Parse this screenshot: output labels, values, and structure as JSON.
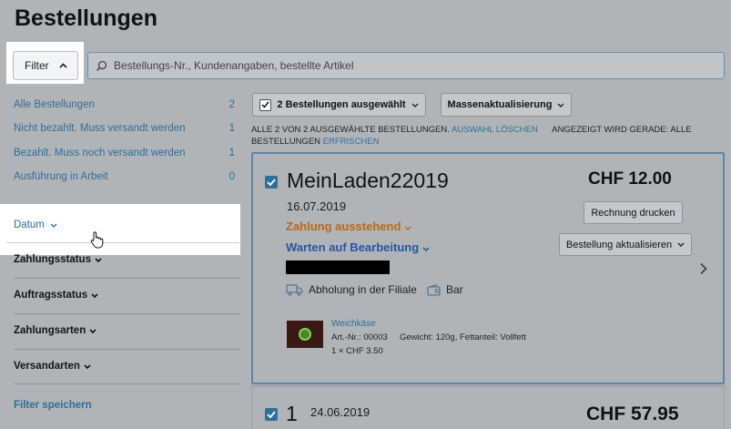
{
  "page": {
    "title": "Bestellungen"
  },
  "filter_button": {
    "label": "Filter"
  },
  "search": {
    "placeholder": "Bestellungs-Nr., Kundenangaben, bestellte Artikel"
  },
  "sidebar": {
    "views": [
      {
        "label": "Alle Bestellungen",
        "count": "2"
      },
      {
        "label": "Nicht bezahlt. Muss versandt werden",
        "count": "1"
      },
      {
        "label": "Bezahlt. Muss noch versandt werden",
        "count": "1"
      },
      {
        "label": "Ausführung in Arbeit",
        "count": "0"
      }
    ],
    "date_filter": "Datum",
    "sections": [
      "Zahlungsstatus",
      "Auftragsstatus",
      "Zahlungsarten",
      "Versandarten"
    ],
    "save_filter": "Filter speichern"
  },
  "toolbar": {
    "selected_label": "2 Bestellungen ausgewählt",
    "mass_update_label": "Massenaktualisierung"
  },
  "selection_info": {
    "text": "Alle 2 von 2 ausgewählte Bestellungen.",
    "clear_link": "Auswahl löschen",
    "showing_text": "Angezeigt wird gerade: Alle Bestellungen",
    "refresh_link": "Erfrischen"
  },
  "orders": [
    {
      "number": "MeinLaden22019",
      "date": "16.07.2019",
      "payment_status": "Zahlung ausstehend",
      "fulfillment_status": "Warten auf Bearbeitung",
      "shipping": "Abholung in der Filiale",
      "payment_method": "Bar",
      "total": "CHF 12.00",
      "print_invoice": "Rechnung drucken",
      "update_order": "Bestellung aktualisieren",
      "item": {
        "name": "Weichkäse",
        "sku": "Art.-Nr.: 00003",
        "attributes": "Gewicht: 120g, Fettanteil: Vollfett",
        "qty": "1 × CHF 3.50"
      }
    },
    {
      "number": "1",
      "date": "24.06.2019",
      "total": "CHF 57.95"
    }
  ],
  "colors": {
    "overlay_bg": "#b1b4b7",
    "link": "#2d6f9a",
    "payment_pending": "#b66a1f",
    "awaiting": "#2556a3",
    "checkbox_accent": "#2e6f9c"
  }
}
